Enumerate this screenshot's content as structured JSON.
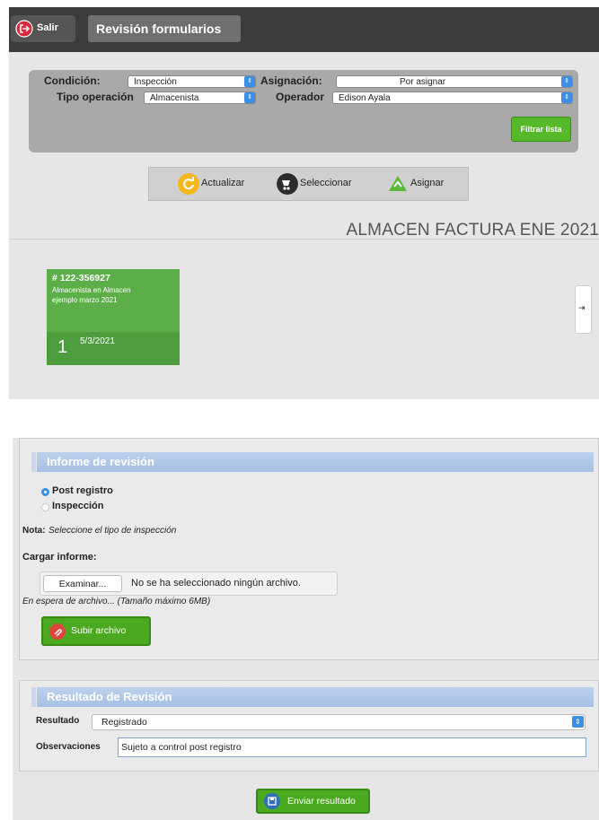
{
  "top": {
    "header": {
      "exit_label": "Salir",
      "title": "Revisión formularios"
    },
    "filters": {
      "condicion_label": "Condición:",
      "condicion_value": "Inspección",
      "asignacion_label": "Asignación:",
      "asignacion_value": "Por asignar",
      "tipo_operacion_label": "Tipo operación",
      "tipo_operacion_value": "Almacenista",
      "operador_label": "Operador",
      "operador_value": "Edison Ayala",
      "filter_button": "Filtrar lista"
    },
    "actions": {
      "refresh": "Actualizar",
      "select": "Seleccionar",
      "assign": "Asignar"
    },
    "form_name": "ALMACEN FACTURA ENE 2021",
    "card": {
      "number": "# 122-356927",
      "line1": "Almacenista en Almacen",
      "line2": "ejemplo marzo 2021",
      "count": "1",
      "date": "5/3/2021"
    },
    "side_toggle": "⇥"
  },
  "bottom": {
    "informe": {
      "header": "Informe de revisión",
      "radio_post": "Post registro",
      "radio_inspeccion": "Inspección",
      "selected": "Post registro",
      "nota_label": "Nota:",
      "nota_text": "Seleccione el tipo de inspección",
      "cargar_label": "Cargar informe:",
      "browse_button": "Examinar...",
      "no_file": "No se ha seleccionado ningún archivo.",
      "waiting": "En espera de archivo... (Tamaño máximo 6MB)",
      "upload_button": "Subir archivo"
    },
    "resultado": {
      "header": "Resultado de Revisión",
      "resultado_label": "Resultado",
      "resultado_value": "Registrado",
      "observaciones_label": "Observaciones",
      "observaciones_value": "Sujeto a control post registro",
      "send_button": "Enviar resultado"
    }
  },
  "colors": {
    "accent_green": "#4aa91f",
    "header_blue": "#a7c0e3",
    "exit_red": "#d9283a",
    "select_blue": "#3b8fe6"
  }
}
